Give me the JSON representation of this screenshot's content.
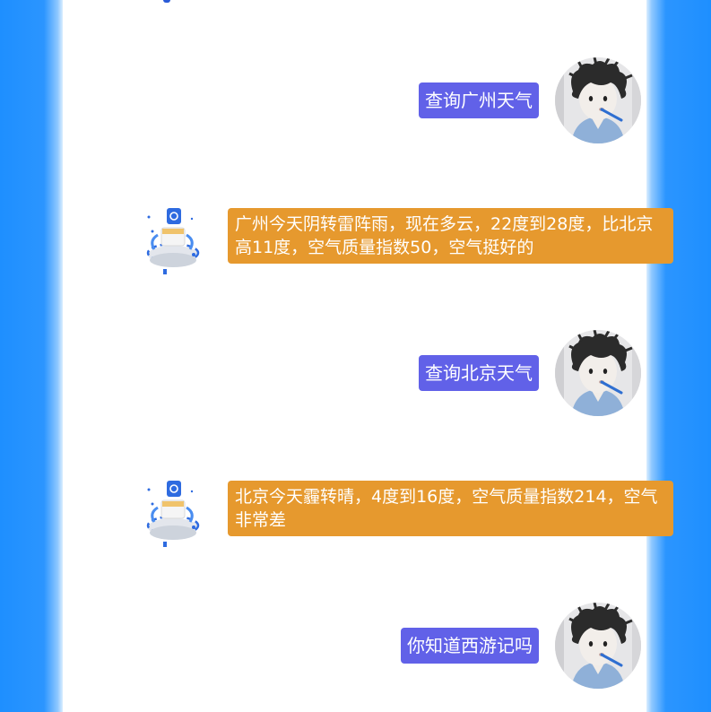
{
  "colors": {
    "background_blue": "#1e8fff",
    "panel": "#ffffff",
    "user_bubble": "#6161e8",
    "bot_bubble": "#e6992e",
    "bubble_text": "#ffffff"
  },
  "messages": [
    {
      "role": "user",
      "text": "查询广州天气",
      "avatar_icon": "user-avatar-cartoon-boy"
    },
    {
      "role": "bot",
      "text": "广州今天阴转雷阵雨，现在多云，22度到28度，比北京高11度，空气质量指数50，空气挺好的",
      "avatar_icon": "bot-avatar-3d-platform"
    },
    {
      "role": "user",
      "text": "查询北京天气",
      "avatar_icon": "user-avatar-cartoon-boy"
    },
    {
      "role": "bot",
      "text": "北京今天霾转晴，4度到16度，空气质量指数214，空气非常差",
      "avatar_icon": "bot-avatar-3d-platform"
    },
    {
      "role": "user",
      "text": "你知道西游记吗",
      "avatar_icon": "user-avatar-cartoon-boy"
    }
  ]
}
